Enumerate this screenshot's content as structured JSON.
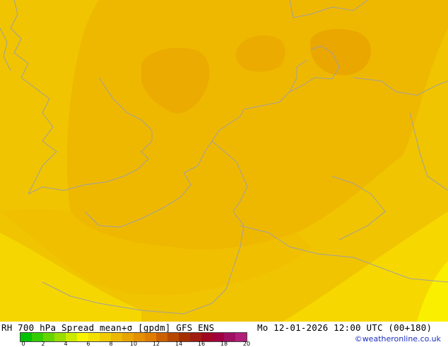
{
  "map": {
    "colors": {
      "background": "#f0c400",
      "level_light": "#f4d000",
      "level_mid": "#f0bd00",
      "level_dark": "#edb000",
      "level_darker": "#e9a800",
      "pale_yellow": "#f8e200",
      "bright_yellow": "#fcf200",
      "coastline": "#a0a0a0"
    }
  },
  "footer": {
    "title": "RH 700 hPa Spread mean+σ [gpdm] GFS ENS",
    "valid_time": "Mo 12-01-2026 12:00 UTC (00+180)",
    "credit": "©weatheronline.co.uk",
    "colorbar": {
      "colors": [
        "#00c000",
        "#33cc00",
        "#66d400",
        "#99dc00",
        "#ccea00",
        "#f8f400",
        "#f4e000",
        "#f0cc00",
        "#ecb800",
        "#e8a400",
        "#e49000",
        "#e07c00",
        "#cc6000",
        "#b84800",
        "#a43000",
        "#a01c10",
        "#a00820",
        "#a00040",
        "#a01060",
        "#b0207a"
      ],
      "ticks": [
        "0",
        "2",
        "4",
        "6",
        "8",
        "10",
        "12",
        "14",
        "16",
        "18",
        "20"
      ]
    }
  }
}
